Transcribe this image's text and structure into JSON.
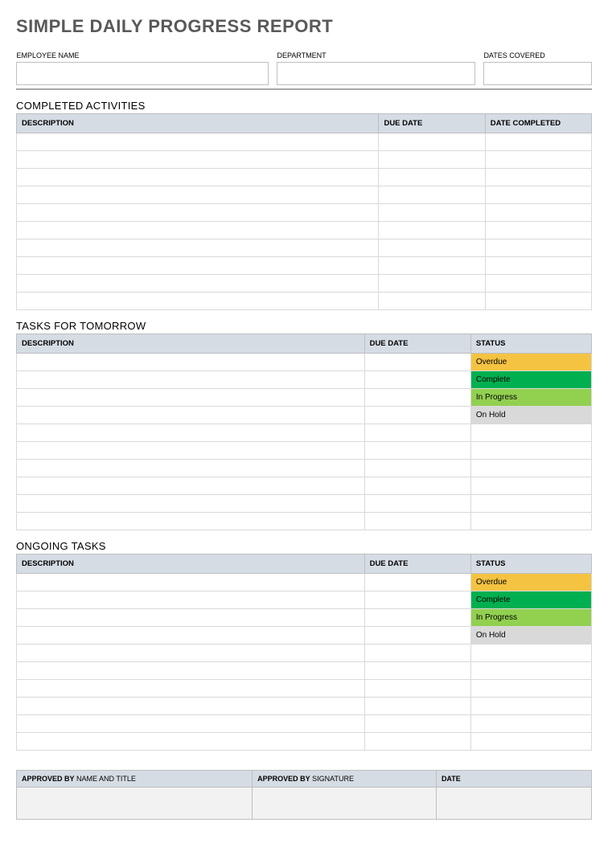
{
  "title": "SIMPLE DAILY PROGRESS REPORT",
  "info": {
    "employee_label": "EMPLOYEE NAME",
    "department_label": "DEPARTMENT",
    "dates_label": "DATES COVERED",
    "employee_value": "",
    "department_value": "",
    "dates_value": ""
  },
  "completed": {
    "heading": "COMPLETED ACTIVITIES",
    "headers": {
      "description": "DESCRIPTION",
      "due_date": "DUE DATE",
      "date_completed": "DATE COMPLETED"
    },
    "rows": [
      {
        "description": "",
        "due_date": "",
        "date_completed": ""
      },
      {
        "description": "",
        "due_date": "",
        "date_completed": ""
      },
      {
        "description": "",
        "due_date": "",
        "date_completed": ""
      },
      {
        "description": "",
        "due_date": "",
        "date_completed": ""
      },
      {
        "description": "",
        "due_date": "",
        "date_completed": ""
      },
      {
        "description": "",
        "due_date": "",
        "date_completed": ""
      },
      {
        "description": "",
        "due_date": "",
        "date_completed": ""
      },
      {
        "description": "",
        "due_date": "",
        "date_completed": ""
      },
      {
        "description": "",
        "due_date": "",
        "date_completed": ""
      },
      {
        "description": "",
        "due_date": "",
        "date_completed": ""
      }
    ]
  },
  "tomorrow": {
    "heading": "TASKS FOR TOMORROW",
    "headers": {
      "description": "DESCRIPTION",
      "due_date": "DUE DATE",
      "status": "STATUS"
    },
    "rows": [
      {
        "description": "",
        "due_date": "",
        "status": "Overdue",
        "status_class": "status-overdue"
      },
      {
        "description": "",
        "due_date": "",
        "status": "Complete",
        "status_class": "status-complete"
      },
      {
        "description": "",
        "due_date": "",
        "status": "In Progress",
        "status_class": "status-inprogress"
      },
      {
        "description": "",
        "due_date": "",
        "status": "On Hold",
        "status_class": "status-onhold"
      },
      {
        "description": "",
        "due_date": "",
        "status": "",
        "status_class": ""
      },
      {
        "description": "",
        "due_date": "",
        "status": "",
        "status_class": ""
      },
      {
        "description": "",
        "due_date": "",
        "status": "",
        "status_class": ""
      },
      {
        "description": "",
        "due_date": "",
        "status": "",
        "status_class": ""
      },
      {
        "description": "",
        "due_date": "",
        "status": "",
        "status_class": ""
      },
      {
        "description": "",
        "due_date": "",
        "status": "",
        "status_class": ""
      }
    ]
  },
  "ongoing": {
    "heading": "ONGOING TASKS",
    "headers": {
      "description": "DESCRIPTION",
      "due_date": "DUE DATE",
      "status": "STATUS"
    },
    "rows": [
      {
        "description": "",
        "due_date": "",
        "status": "Overdue",
        "status_class": "status-overdue"
      },
      {
        "description": "",
        "due_date": "",
        "status": "Complete",
        "status_class": "status-complete"
      },
      {
        "description": "",
        "due_date": "",
        "status": "In Progress",
        "status_class": "status-inprogress"
      },
      {
        "description": "",
        "due_date": "",
        "status": "On Hold",
        "status_class": "status-onhold"
      },
      {
        "description": "",
        "due_date": "",
        "status": "",
        "status_class": ""
      },
      {
        "description": "",
        "due_date": "",
        "status": "",
        "status_class": ""
      },
      {
        "description": "",
        "due_date": "",
        "status": "",
        "status_class": ""
      },
      {
        "description": "",
        "due_date": "",
        "status": "",
        "status_class": ""
      },
      {
        "description": "",
        "due_date": "",
        "status": "",
        "status_class": ""
      },
      {
        "description": "",
        "due_date": "",
        "status": "",
        "status_class": ""
      }
    ]
  },
  "approval": {
    "approved_by_bold": "APPROVED BY",
    "name_title_label": " NAME AND TITLE",
    "signature_label": " SIGNATURE",
    "date_label": "DATE",
    "name_title_value": "",
    "signature_value": "",
    "date_value": ""
  }
}
